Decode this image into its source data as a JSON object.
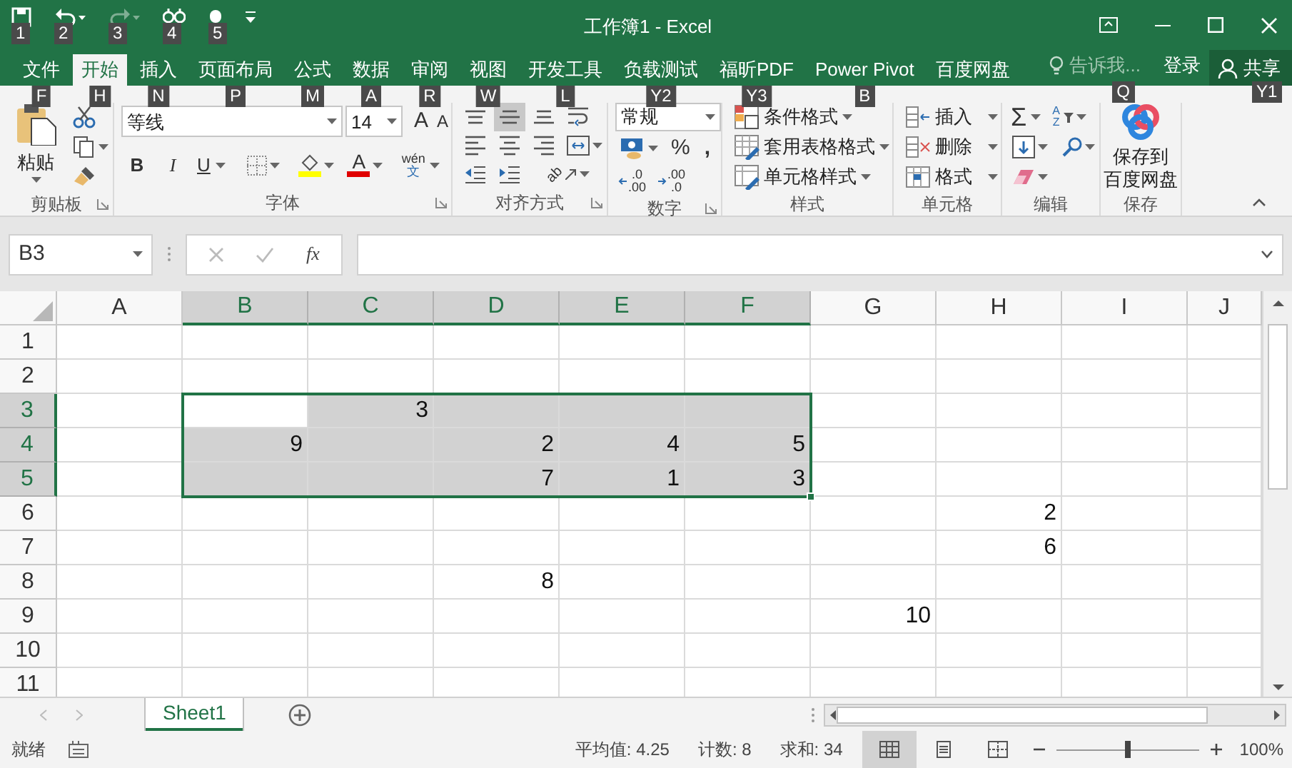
{
  "title_bar": {
    "title": "工作簿1 - Excel",
    "quick_access": [
      {
        "kind": "save",
        "keytip": "1",
        "disabled": false
      },
      {
        "kind": "undo",
        "keytip": "2",
        "disabled": false
      },
      {
        "kind": "redo",
        "keytip": "3",
        "disabled": true
      },
      {
        "kind": "touch",
        "keytip": "4",
        "disabled": false
      },
      {
        "kind": "mouse",
        "keytip": "5",
        "disabled": false
      }
    ]
  },
  "tabs": [
    {
      "label": "文件",
      "selected": false,
      "keytip": "F"
    },
    {
      "label": "开始",
      "selected": true,
      "keytip": "H"
    },
    {
      "label": "插入",
      "selected": false,
      "keytip": "N"
    },
    {
      "label": "页面布局",
      "selected": false,
      "keytip": "P"
    },
    {
      "label": "公式",
      "selected": false,
      "keytip": "M"
    },
    {
      "label": "数据",
      "selected": false,
      "keytip": "A"
    },
    {
      "label": "审阅",
      "selected": false,
      "keytip": "R"
    },
    {
      "label": "视图",
      "selected": false,
      "keytip": "W"
    },
    {
      "label": "开发工具",
      "selected": false,
      "keytip": "L"
    },
    {
      "label": "负载测试",
      "selected": false,
      "keytip": "Y2"
    },
    {
      "label": "福昕PDF",
      "selected": false,
      "keytip": "Y3"
    },
    {
      "label": "Power Pivot",
      "selected": false,
      "keytip": "B"
    },
    {
      "label": "百度网盘",
      "selected": false
    }
  ],
  "tell_me": {
    "text": "告诉我...",
    "keytip": "Q"
  },
  "sign_in": "登录",
  "share": {
    "label": "共享",
    "keytip": "Y1"
  },
  "ribbon": {
    "clipboard": {
      "label": "剪贴板",
      "paste": "粘贴"
    },
    "font": {
      "label": "字体",
      "font_name": "等线",
      "font_size": "14",
      "grow_font": "A",
      "shrink_font": "A",
      "bold": "B",
      "italic": "I",
      "underline": "U",
      "font_color": "A",
      "phonetic": [
        "wén",
        "文"
      ]
    },
    "alignment": {
      "label": "对齐方式",
      "vertical_align": [
        {
          "selected": false
        },
        {
          "selected": true
        },
        {
          "selected": false
        }
      ],
      "horizontal_align": [
        {
          "selected": false
        },
        {
          "selected": false
        },
        {
          "selected": false
        }
      ],
      "orientation": "ab"
    },
    "number": {
      "label": "数字",
      "format": "常规",
      "percent": "%",
      "comma": ",",
      "increase_decimal": [
        ".0",
        ".00"
      ],
      "decrease_decimal": [
        ".00",
        ".0"
      ]
    },
    "styles": {
      "label": "样式",
      "items": [
        {
          "kind": "conditional",
          "label": "条件格式"
        },
        {
          "kind": "table",
          "label": "套用表格格式"
        },
        {
          "kind": "cell_style",
          "label": "单元格样式"
        }
      ]
    },
    "cells": {
      "label": "单元格",
      "items": [
        {
          "kind": "insert",
          "label": "插入"
        },
        {
          "kind": "delete",
          "label": "删除"
        },
        {
          "kind": "format",
          "label": "格式"
        }
      ]
    },
    "editing": {
      "label": "编辑",
      "autosum": "Σ",
      "sort": [
        "A",
        "Z"
      ]
    },
    "save": {
      "label": "保存",
      "button": [
        "保存到",
        "百度网盘"
      ]
    }
  },
  "formula_bar": {
    "name_box": "B3",
    "fx": "fx"
  },
  "grid": {
    "columns": [
      {
        "label": "A",
        "selected": false
      },
      {
        "label": "B",
        "selected": true
      },
      {
        "label": "C",
        "selected": true
      },
      {
        "label": "D",
        "selected": true
      },
      {
        "label": "E",
        "selected": true
      },
      {
        "label": "F",
        "selected": true
      },
      {
        "label": "G",
        "selected": false
      },
      {
        "label": "H",
        "selected": false
      },
      {
        "label": "I",
        "selected": false
      },
      {
        "label": "J",
        "selected": false
      }
    ],
    "rows": [
      {
        "label": "1",
        "selected": false,
        "cells": [
          {},
          {},
          {},
          {},
          {},
          {},
          {},
          {},
          {},
          {}
        ]
      },
      {
        "label": "2",
        "selected": false,
        "cells": [
          {},
          {},
          {},
          {},
          {},
          {},
          {},
          {},
          {},
          {}
        ]
      },
      {
        "label": "3",
        "selected": true,
        "cells": [
          {},
          {
            "selected": true,
            "active": true
          },
          {
            "selected": true,
            "value": "3"
          },
          {
            "selected": true
          },
          {
            "selected": true
          },
          {
            "selected": true
          },
          {},
          {},
          {},
          {}
        ]
      },
      {
        "label": "4",
        "selected": true,
        "cells": [
          {},
          {
            "selected": true,
            "value": "9"
          },
          {
            "selected": true
          },
          {
            "selected": true,
            "value": "2"
          },
          {
            "selected": true,
            "value": "4"
          },
          {
            "selected": true,
            "value": "5"
          },
          {},
          {},
          {},
          {}
        ]
      },
      {
        "label": "5",
        "selected": true,
        "cells": [
          {},
          {
            "selected": true
          },
          {
            "selected": true
          },
          {
            "selected": true,
            "value": "7"
          },
          {
            "selected": true,
            "value": "1"
          },
          {
            "selected": true,
            "value": "3"
          },
          {},
          {},
          {},
          {}
        ]
      },
      {
        "label": "6",
        "selected": false,
        "cells": [
          {},
          {},
          {},
          {},
          {},
          {},
          {},
          {
            "value": "2"
          },
          {},
          {}
        ]
      },
      {
        "label": "7",
        "selected": false,
        "cells": [
          {},
          {},
          {},
          {},
          {},
          {},
          {},
          {
            "value": "6"
          },
          {},
          {}
        ]
      },
      {
        "label": "8",
        "selected": false,
        "cells": [
          {},
          {},
          {},
          {
            "value": "8"
          },
          {},
          {},
          {},
          {},
          {},
          {}
        ]
      },
      {
        "label": "9",
        "selected": false,
        "cells": [
          {},
          {},
          {},
          {},
          {},
          {},
          {
            "value": "10"
          },
          {},
          {},
          {}
        ]
      },
      {
        "label": "10",
        "selected": false,
        "cells": [
          {},
          {},
          {},
          {},
          {},
          {},
          {},
          {},
          {},
          {}
        ]
      },
      {
        "label": "11",
        "selected": false,
        "cells": [
          {},
          {},
          {},
          {},
          {},
          {},
          {},
          {},
          {},
          {}
        ]
      }
    ]
  },
  "sheet_tabs": [
    {
      "label": "Sheet1",
      "selected": true
    }
  ],
  "status_bar": {
    "mode": "就绪",
    "average": "平均值: 4.25",
    "count": "计数: 8",
    "sum": "求和: 34",
    "views": [
      {
        "kind": "normal",
        "selected": true
      },
      {
        "kind": "page_layout",
        "selected": false
      },
      {
        "kind": "page_break",
        "selected": false
      }
    ],
    "zoom_slider": {
      "level": 0.5
    },
    "zoom": "100%"
  }
}
